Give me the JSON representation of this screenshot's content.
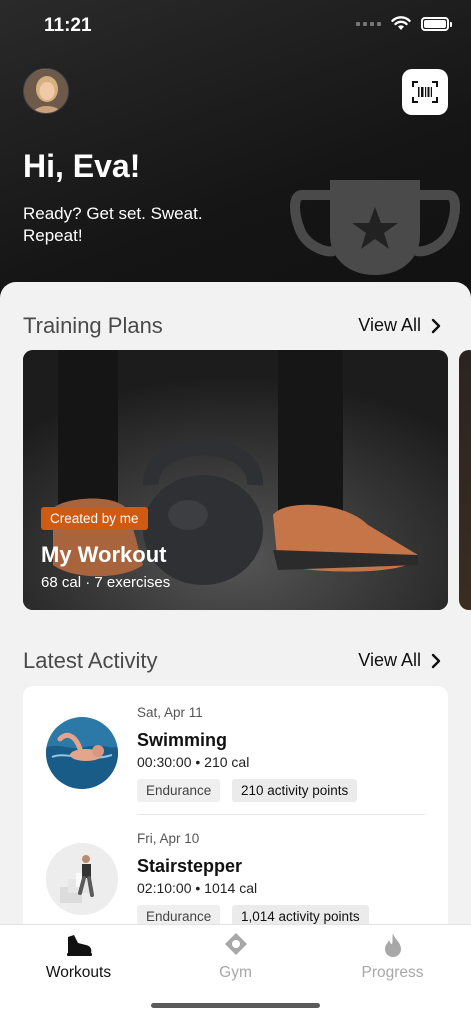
{
  "status_bar": {
    "time": "11:21"
  },
  "header": {
    "greeting": "Hi, Eva!",
    "tagline": "Ready? Get set. Sweat. Repeat!"
  },
  "training_plans": {
    "title": "Training Plans",
    "view_all": "View All",
    "cards": [
      {
        "badge": "Created by me",
        "title": "My Workout",
        "meta": "68 cal · 7 exercises"
      }
    ]
  },
  "latest_activity": {
    "title": "Latest Activity",
    "view_all": "View All",
    "items": [
      {
        "date": "Sat, Apr 11",
        "name": "Swimming",
        "stats": "00:30:00 • 210 cal",
        "tag": "Endurance",
        "points": "210 activity points"
      },
      {
        "date": "Fri, Apr 10",
        "name": "Stairstepper",
        "stats": "02:10:00 • 1014 cal",
        "tag": "Endurance",
        "points": "1,014 activity points"
      }
    ]
  },
  "tabs": [
    {
      "label": "Workouts",
      "icon": "shoe-icon",
      "active": true
    },
    {
      "label": "Gym",
      "icon": "location-pin-icon",
      "active": false
    },
    {
      "label": "Progress",
      "icon": "flame-icon",
      "active": false
    }
  ],
  "colors": {
    "accent": "#cf5a11",
    "active_tab": "#111111",
    "inactive_tab": "#a8a8a8"
  }
}
